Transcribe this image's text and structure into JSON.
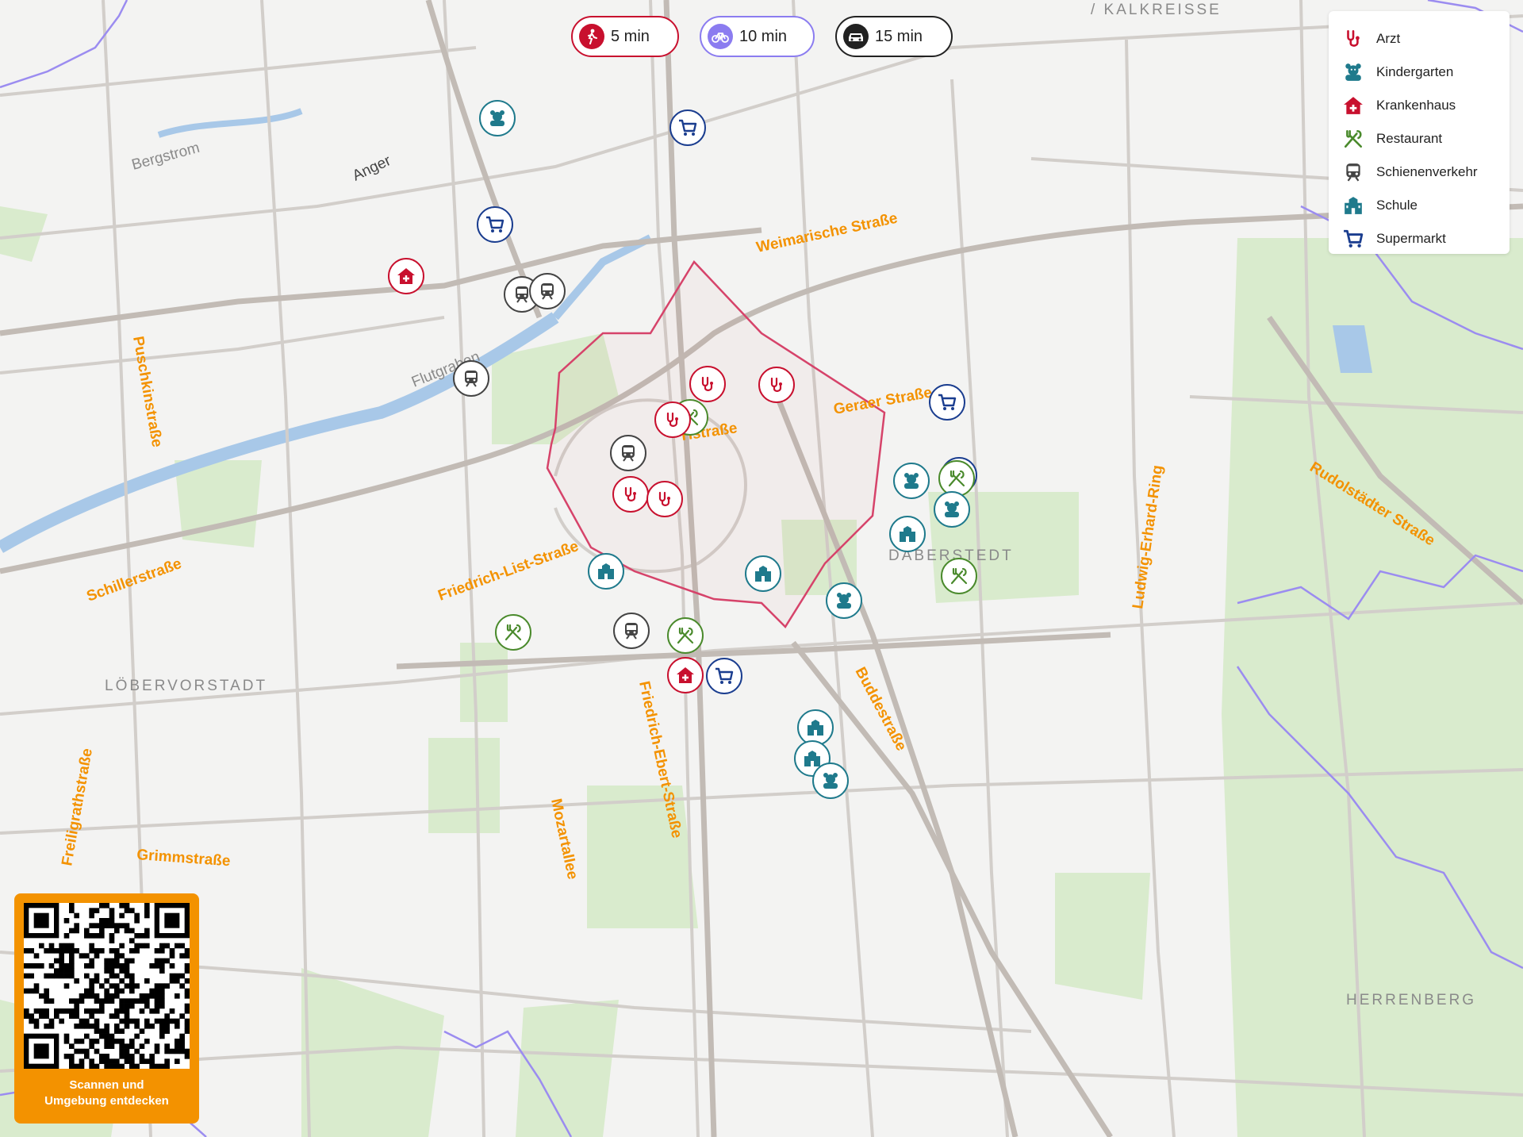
{
  "travel_modes": [
    {
      "label": "5 min",
      "mode": "walk",
      "icon": "walking-person-icon",
      "color": "#c8102e",
      "active": true
    },
    {
      "label": "10 min",
      "mode": "bike",
      "icon": "bicycle-icon",
      "color": "#7b68ee",
      "active": false
    },
    {
      "label": "15 min",
      "mode": "car",
      "icon": "car-icon",
      "color": "#222222",
      "active": false
    }
  ],
  "legend": [
    {
      "label": "Arzt",
      "icon": "stethoscope-icon",
      "color": "#c8102e"
    },
    {
      "label": "Kindergarten",
      "icon": "teddy-bear-icon",
      "color": "#1f7a8c"
    },
    {
      "label": "Krankenhaus",
      "icon": "hospital-icon",
      "color": "#c8102e"
    },
    {
      "label": "Restaurant",
      "icon": "fork-knife-icon",
      "color": "#4a8a2c"
    },
    {
      "label": "Schienenverkehr",
      "icon": "train-icon",
      "color": "#444444"
    },
    {
      "label": "Schule",
      "icon": "school-icon",
      "color": "#1f7a8c"
    },
    {
      "label": "Supermarkt",
      "icon": "shopping-cart-icon",
      "color": "#1a3d8f"
    }
  ],
  "street_labels": [
    {
      "text": "Weimarische Straße"
    },
    {
      "text": "Schillerstraße"
    },
    {
      "text": "Friedrich-List-Straße"
    },
    {
      "text": "Puschkinstraße"
    },
    {
      "text": "Geraer Straße"
    },
    {
      "text": "Buddestraße"
    },
    {
      "text": "Friedrich-Ebert-Straße"
    },
    {
      "text": "Mozartallee"
    },
    {
      "text": "Grimmstraße"
    },
    {
      "text": "Freiligrathstraße"
    },
    {
      "text": "Ludwig-Erhard-Ring"
    },
    {
      "text": "Rudolstädter Straße"
    },
    {
      "text": "Hstraße"
    }
  ],
  "place_labels": [
    {
      "text": "LÖBERVORSTADT"
    },
    {
      "text": "DABERSTEDT"
    },
    {
      "text": "HERRENBERG"
    },
    {
      "text": "/ KALKREISSE"
    },
    {
      "text": "Anger"
    },
    {
      "text": "Bergstrom"
    },
    {
      "text": "Flutgraben"
    }
  ],
  "pois": [
    {
      "category": "Kindergarten"
    },
    {
      "category": "Supermarkt"
    },
    {
      "category": "Supermarkt"
    },
    {
      "category": "Krankenhaus"
    },
    {
      "category": "Schienenverkehr"
    },
    {
      "category": "Schienenverkehr"
    },
    {
      "category": "Schienenverkehr"
    },
    {
      "category": "Arzt"
    },
    {
      "category": "Arzt"
    },
    {
      "category": "Restaurant"
    },
    {
      "category": "Arzt"
    },
    {
      "category": "Schienenverkehr"
    },
    {
      "category": "Arzt"
    },
    {
      "category": "Arzt"
    },
    {
      "category": "Supermarkt"
    },
    {
      "category": "Supermarkt"
    },
    {
      "category": "Kindergarten"
    },
    {
      "category": "Restaurant"
    },
    {
      "category": "Kindergarten"
    },
    {
      "category": "Schule"
    },
    {
      "category": "Restaurant"
    },
    {
      "category": "Schule"
    },
    {
      "category": "Kindergarten"
    },
    {
      "category": "Schule"
    },
    {
      "category": "Restaurant"
    },
    {
      "category": "Schienenverkehr"
    },
    {
      "category": "Restaurant"
    },
    {
      "category": "Krankenhaus"
    },
    {
      "category": "Supermarkt"
    },
    {
      "category": "Schule"
    },
    {
      "category": "Schule"
    },
    {
      "category": "Kindergarten"
    }
  ],
  "qr_panel": {
    "caption_line1": "Scannen und",
    "caption_line2": "Umgebung entdecken"
  }
}
